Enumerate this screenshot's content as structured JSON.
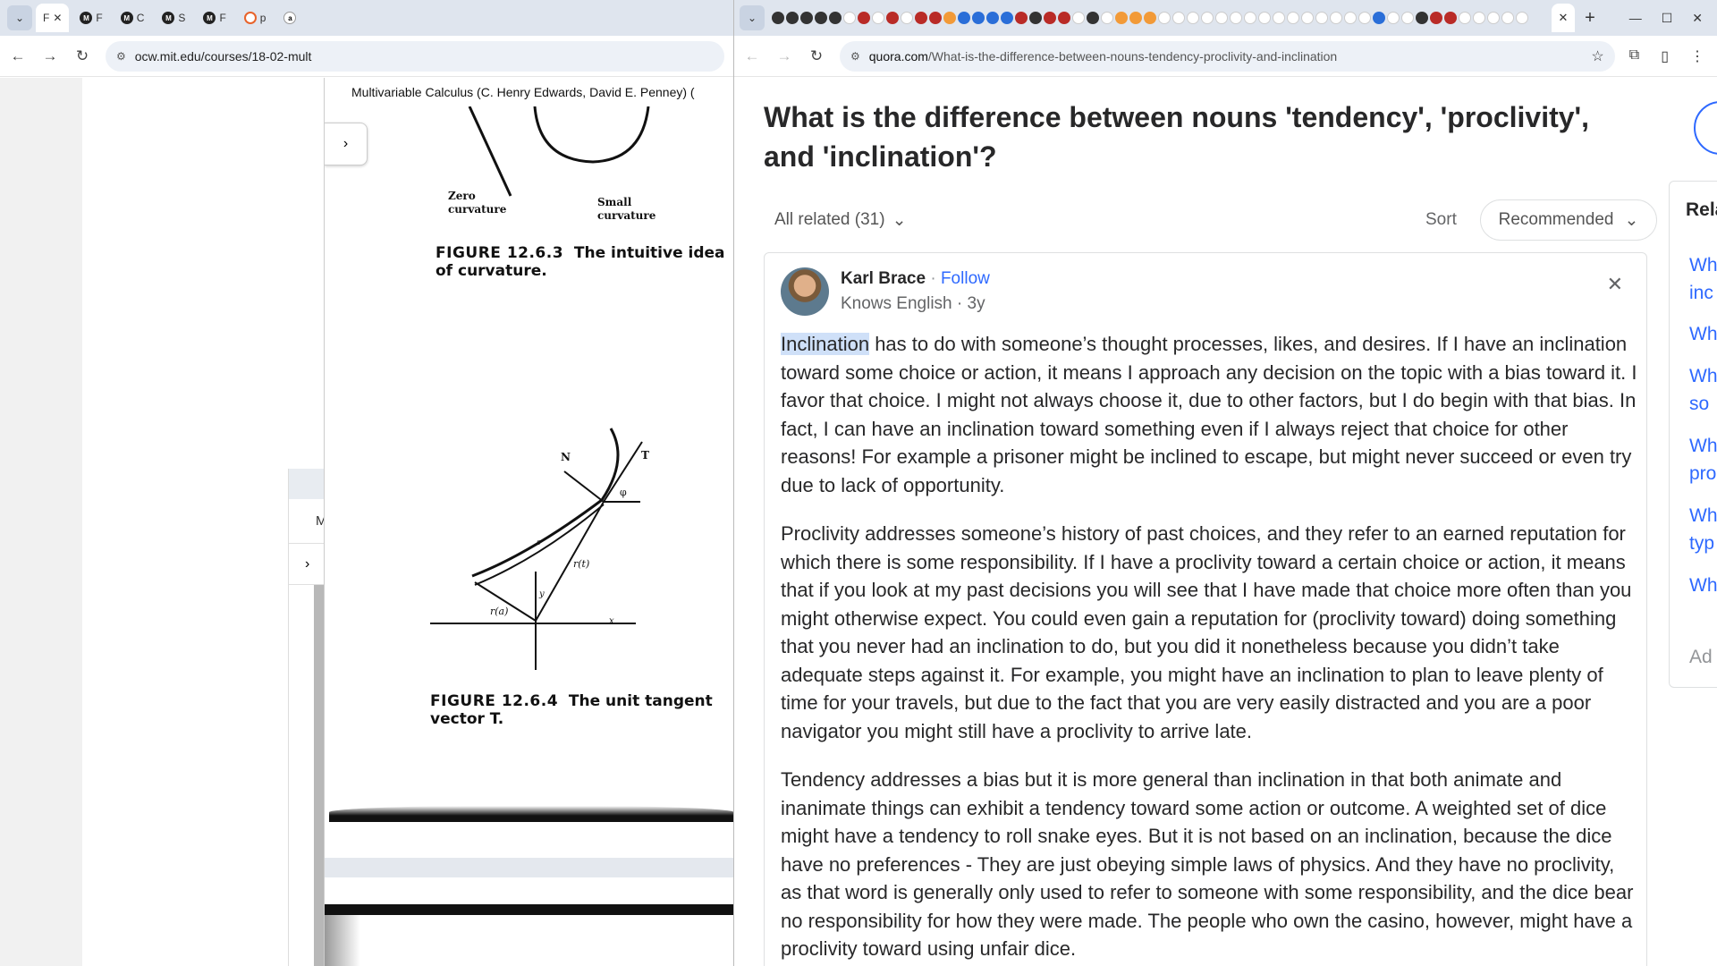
{
  "left_window": {
    "tabs": [
      {
        "label": "F",
        "active": true,
        "icon": "google-docs-icon"
      },
      {
        "label": "F",
        "icon": "mit-ocw-icon"
      },
      {
        "label": "C",
        "icon": "mit-ocw-icon"
      },
      {
        "label": "S",
        "icon": "mit-ocw-icon"
      },
      {
        "label": "F",
        "icon": "mit-ocw-icon"
      },
      {
        "label": "p",
        "icon": "orange-circle-icon"
      },
      {
        "label": "a",
        "icon": "amazon-icon"
      }
    ],
    "url": "ocw.mit.edu/courses/18-02-mult",
    "pdf_title": "Multivariable Calculus (C. Henry Edwards, David E. Penney) (",
    "panel_label": "M",
    "scan": {
      "label_zero": "Zero",
      "label_curvature_1": "curvature",
      "label_small": "Small",
      "label_curvature_2": "curvature",
      "figure_1263_num": "FIGURE 12.6.3",
      "figure_1263_text_1": "The intuitive idea",
      "figure_1263_text_2": "of curvature.",
      "label_N": "N",
      "label_T": "T",
      "label_phi": "φ",
      "label_rt": "r(t)",
      "label_ra": "r(a)",
      "label_y": "y",
      "label_x": "x",
      "label_s": "s",
      "figure_1264_num": "FIGURE 12.6.4",
      "figure_1264_text_1": "The unit tangent",
      "figure_1264_text_2": "vector T."
    }
  },
  "right_window": {
    "url_host": "quora.com",
    "url_path": "/What-is-the-difference-between-nouns-tendency-proclivity-and-inclination",
    "question_title": "What is the difference between nouns 'tendency', 'proclivity', and 'inclination'?",
    "all_related": "All related (31)",
    "sort_label": "Sort",
    "sort_value": "Recommended",
    "answer": {
      "author": "Karl Brace",
      "follow_sep": " · ",
      "follow": "Follow",
      "meta": "Knows English · 3y",
      "p1_highlight": "Inclination",
      "p1_rest": " has to do with someone’s thought processes, likes, and desires. If I have an inclination toward some choice or action, it means I approach any decision on the topic with a bias toward it. I favor that choice. I might not always choose it, due to other factors, but I do begin with that bias. In fact, I can have an inclination toward something even if I always reject that choice for other reasons! For example a prisoner might be inclined to escape, but might never succeed or even try due to lack of opportunity.",
      "p2": "Proclivity addresses someone’s history of past choices, and they refer to an earned reputation for which there is some responsibility. If I have a proclivity toward a certain choice or action, it means that if you look at my past decisions you will see that I have made that choice more often than you might otherwise expect. You could even gain a reputation for (proclivity toward) doing something that you never had an inclination to do, but you did it nonetheless because you didn’t take adequate steps against it. For example, you might have an inclination to plan to leave plenty of time for your travels, but due to the fact that you are very easily distracted and you are a poor navigator you might still have a proclivity to arrive late.",
      "p3": "Tendency addresses a bias but it is more general than inclination in that both animate and inanimate things can exhibit a tendency toward some action or outcome. A weighted set of dice might have a tendency to roll snake eyes. But it is not based on an inclination, because the dice have no preferences - They are just obeying simple laws of physics. And they have no proclivity, as that word is generally only used to refer to someone with some responsibility, and the dice bear no responsibility for how they were made. The people who own the casino, however, might have a proclivity toward using unfair dice."
    },
    "related": {
      "heading": "Rela",
      "links": [
        "Wh",
        "inc",
        "Wh",
        "Wh",
        "so",
        "Wh",
        "pro",
        "Wh",
        "typ",
        "Wh"
      ],
      "more": "Ad"
    }
  },
  "colors": {
    "quora_link": "#2e69ff",
    "quora_text": "#282829",
    "highlight": "#cfe0f8",
    "tabstrip": "#dfe5ee"
  }
}
